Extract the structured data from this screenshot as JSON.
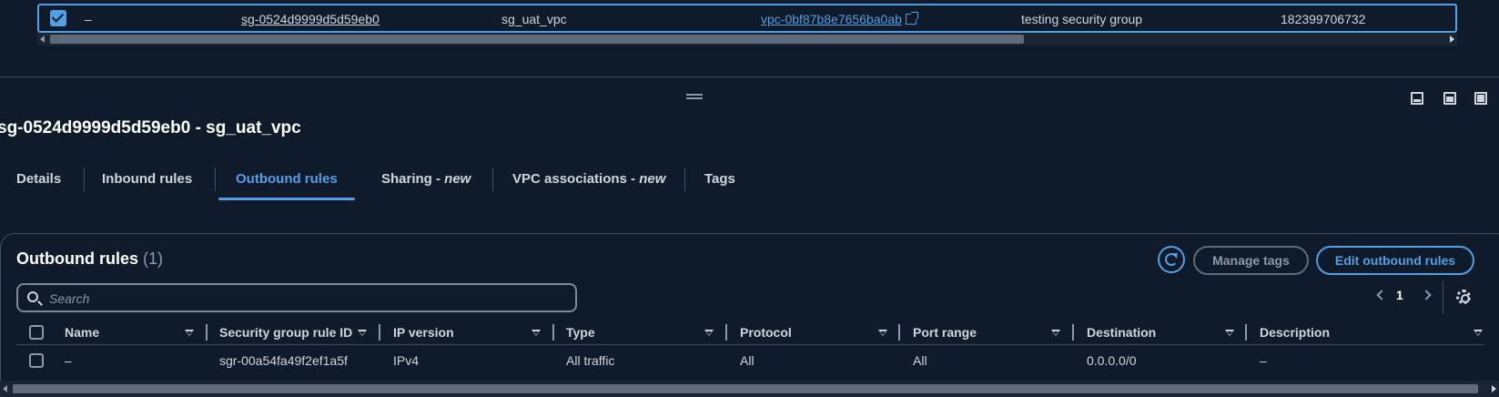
{
  "selected_row": {
    "dash": "–",
    "sg_id": "sg-0524d9999d5d59eb0",
    "name": "sg_uat_vpc",
    "vpc_id": "vpc-0bf87b8e7656ba0ab",
    "description": "testing security group",
    "owner": "182399706732"
  },
  "detail": {
    "title": "sg-0524d9999d5d59eb0 - sg_uat_vpc",
    "tabs": [
      {
        "label": "Details"
      },
      {
        "label": "Inbound rules"
      },
      {
        "label": "Outbound rules",
        "active": true
      },
      {
        "label": "Sharing - ",
        "badge": "new"
      },
      {
        "label": "VPC associations - ",
        "badge": "new"
      },
      {
        "label": "Tags"
      }
    ]
  },
  "outbound": {
    "title": "Outbound rules",
    "count": "(1)",
    "manage_tags": "Manage tags",
    "edit_button": "Edit outbound rules",
    "search_placeholder": "Search",
    "page": "1",
    "columns": [
      "Name",
      "Security group rule ID",
      "IP version",
      "Type",
      "Protocol",
      "Port range",
      "Destination",
      "Description"
    ],
    "rows": [
      [
        "–",
        "sgr-00a54fa49f2ef1a5f",
        "IPv4",
        "All traffic",
        "All",
        "All",
        "0.0.0.0/0",
        "–"
      ]
    ]
  },
  "colors": {
    "background": "#0f1b2a",
    "accent": "#539fe5",
    "border": "#414d5c"
  },
  "icons": [
    "checkbox-checked-icon",
    "external-link-icon",
    "drag-handle-icon",
    "panel-layout-icon",
    "refresh-icon",
    "search-icon",
    "chevron-left-icon",
    "chevron-right-icon",
    "gear-icon",
    "sort-icon"
  ]
}
